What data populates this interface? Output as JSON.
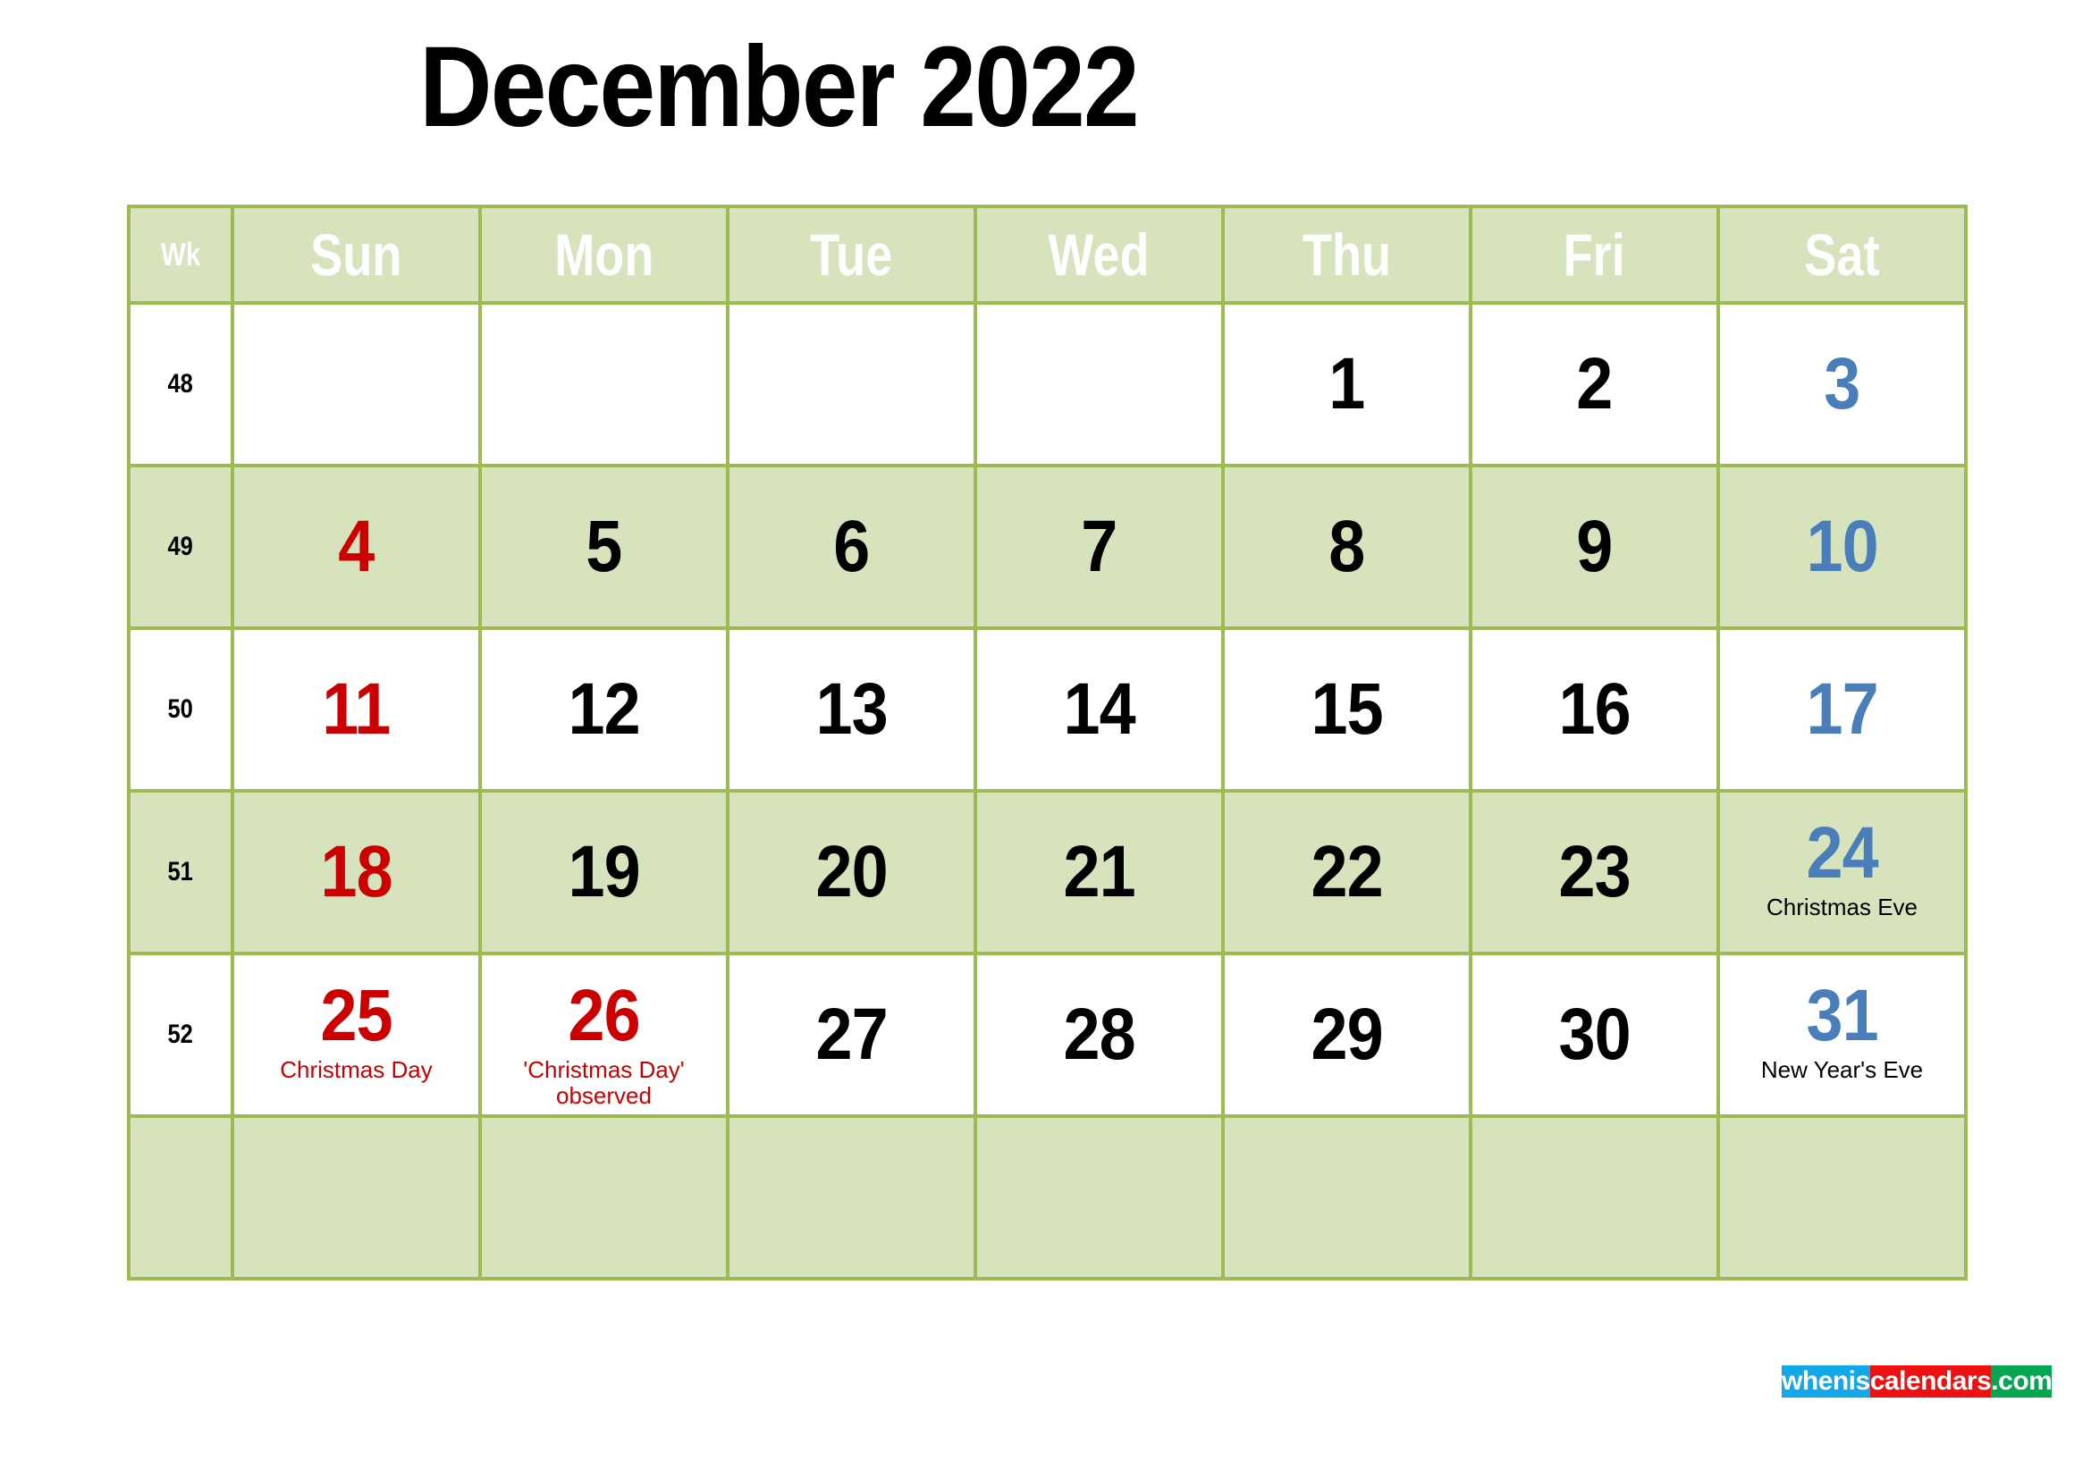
{
  "title": "December 2022",
  "header": {
    "week_label": "Wk",
    "days": [
      "Sun",
      "Mon",
      "Tue",
      "Wed",
      "Thu",
      "Fri",
      "Sat"
    ]
  },
  "colors": {
    "grid_border": "#9cbb51",
    "shaded_row": "#d7e3bc",
    "header_bg": "#d7e3bc",
    "header_text": "#ffffff",
    "sunday": "#cc0000",
    "saturday": "#4a7ebb",
    "weekday": "#000000",
    "holiday": "#cc0000"
  },
  "weeks": [
    {
      "wk": "48",
      "shaded": false,
      "days": [
        {
          "num": "",
          "kind": "empty",
          "event": ""
        },
        {
          "num": "",
          "kind": "empty",
          "event": ""
        },
        {
          "num": "",
          "kind": "empty",
          "event": ""
        },
        {
          "num": "",
          "kind": "empty",
          "event": ""
        },
        {
          "num": "1",
          "kind": "weekday",
          "event": ""
        },
        {
          "num": "2",
          "kind": "weekday",
          "event": ""
        },
        {
          "num": "3",
          "kind": "sat",
          "event": ""
        }
      ]
    },
    {
      "wk": "49",
      "shaded": true,
      "days": [
        {
          "num": "4",
          "kind": "sun",
          "event": ""
        },
        {
          "num": "5",
          "kind": "weekday",
          "event": ""
        },
        {
          "num": "6",
          "kind": "weekday",
          "event": ""
        },
        {
          "num": "7",
          "kind": "weekday",
          "event": ""
        },
        {
          "num": "8",
          "kind": "weekday",
          "event": ""
        },
        {
          "num": "9",
          "kind": "weekday",
          "event": ""
        },
        {
          "num": "10",
          "kind": "sat",
          "event": ""
        }
      ]
    },
    {
      "wk": "50",
      "shaded": false,
      "days": [
        {
          "num": "11",
          "kind": "sun",
          "event": ""
        },
        {
          "num": "12",
          "kind": "weekday",
          "event": ""
        },
        {
          "num": "13",
          "kind": "weekday",
          "event": ""
        },
        {
          "num": "14",
          "kind": "weekday",
          "event": ""
        },
        {
          "num": "15",
          "kind": "weekday",
          "event": ""
        },
        {
          "num": "16",
          "kind": "weekday",
          "event": ""
        },
        {
          "num": "17",
          "kind": "sat",
          "event": ""
        }
      ]
    },
    {
      "wk": "51",
      "shaded": true,
      "days": [
        {
          "num": "18",
          "kind": "sun",
          "event": ""
        },
        {
          "num": "19",
          "kind": "weekday",
          "event": ""
        },
        {
          "num": "20",
          "kind": "weekday",
          "event": ""
        },
        {
          "num": "21",
          "kind": "weekday",
          "event": ""
        },
        {
          "num": "22",
          "kind": "weekday",
          "event": ""
        },
        {
          "num": "23",
          "kind": "weekday",
          "event": ""
        },
        {
          "num": "24",
          "kind": "sat",
          "event": "Christmas Eve",
          "event_color": "black"
        }
      ]
    },
    {
      "wk": "52",
      "shaded": false,
      "days": [
        {
          "num": "25",
          "kind": "sun",
          "event": "Christmas Day",
          "event_color": "red"
        },
        {
          "num": "26",
          "kind": "hol",
          "event": "'Christmas Day'\nobserved",
          "event_color": "red"
        },
        {
          "num": "27",
          "kind": "weekday",
          "event": ""
        },
        {
          "num": "28",
          "kind": "weekday",
          "event": ""
        },
        {
          "num": "29",
          "kind": "weekday",
          "event": ""
        },
        {
          "num": "30",
          "kind": "weekday",
          "event": ""
        },
        {
          "num": "31",
          "kind": "sat",
          "event": "New Year's Eve",
          "event_color": "black"
        }
      ]
    }
  ],
  "blank_row": {
    "wk": "",
    "days": [
      "",
      "",
      "",
      "",
      "",
      "",
      ""
    ]
  },
  "logo": {
    "part1": "whenis",
    "part2": "calendars",
    "part3": ".com"
  }
}
